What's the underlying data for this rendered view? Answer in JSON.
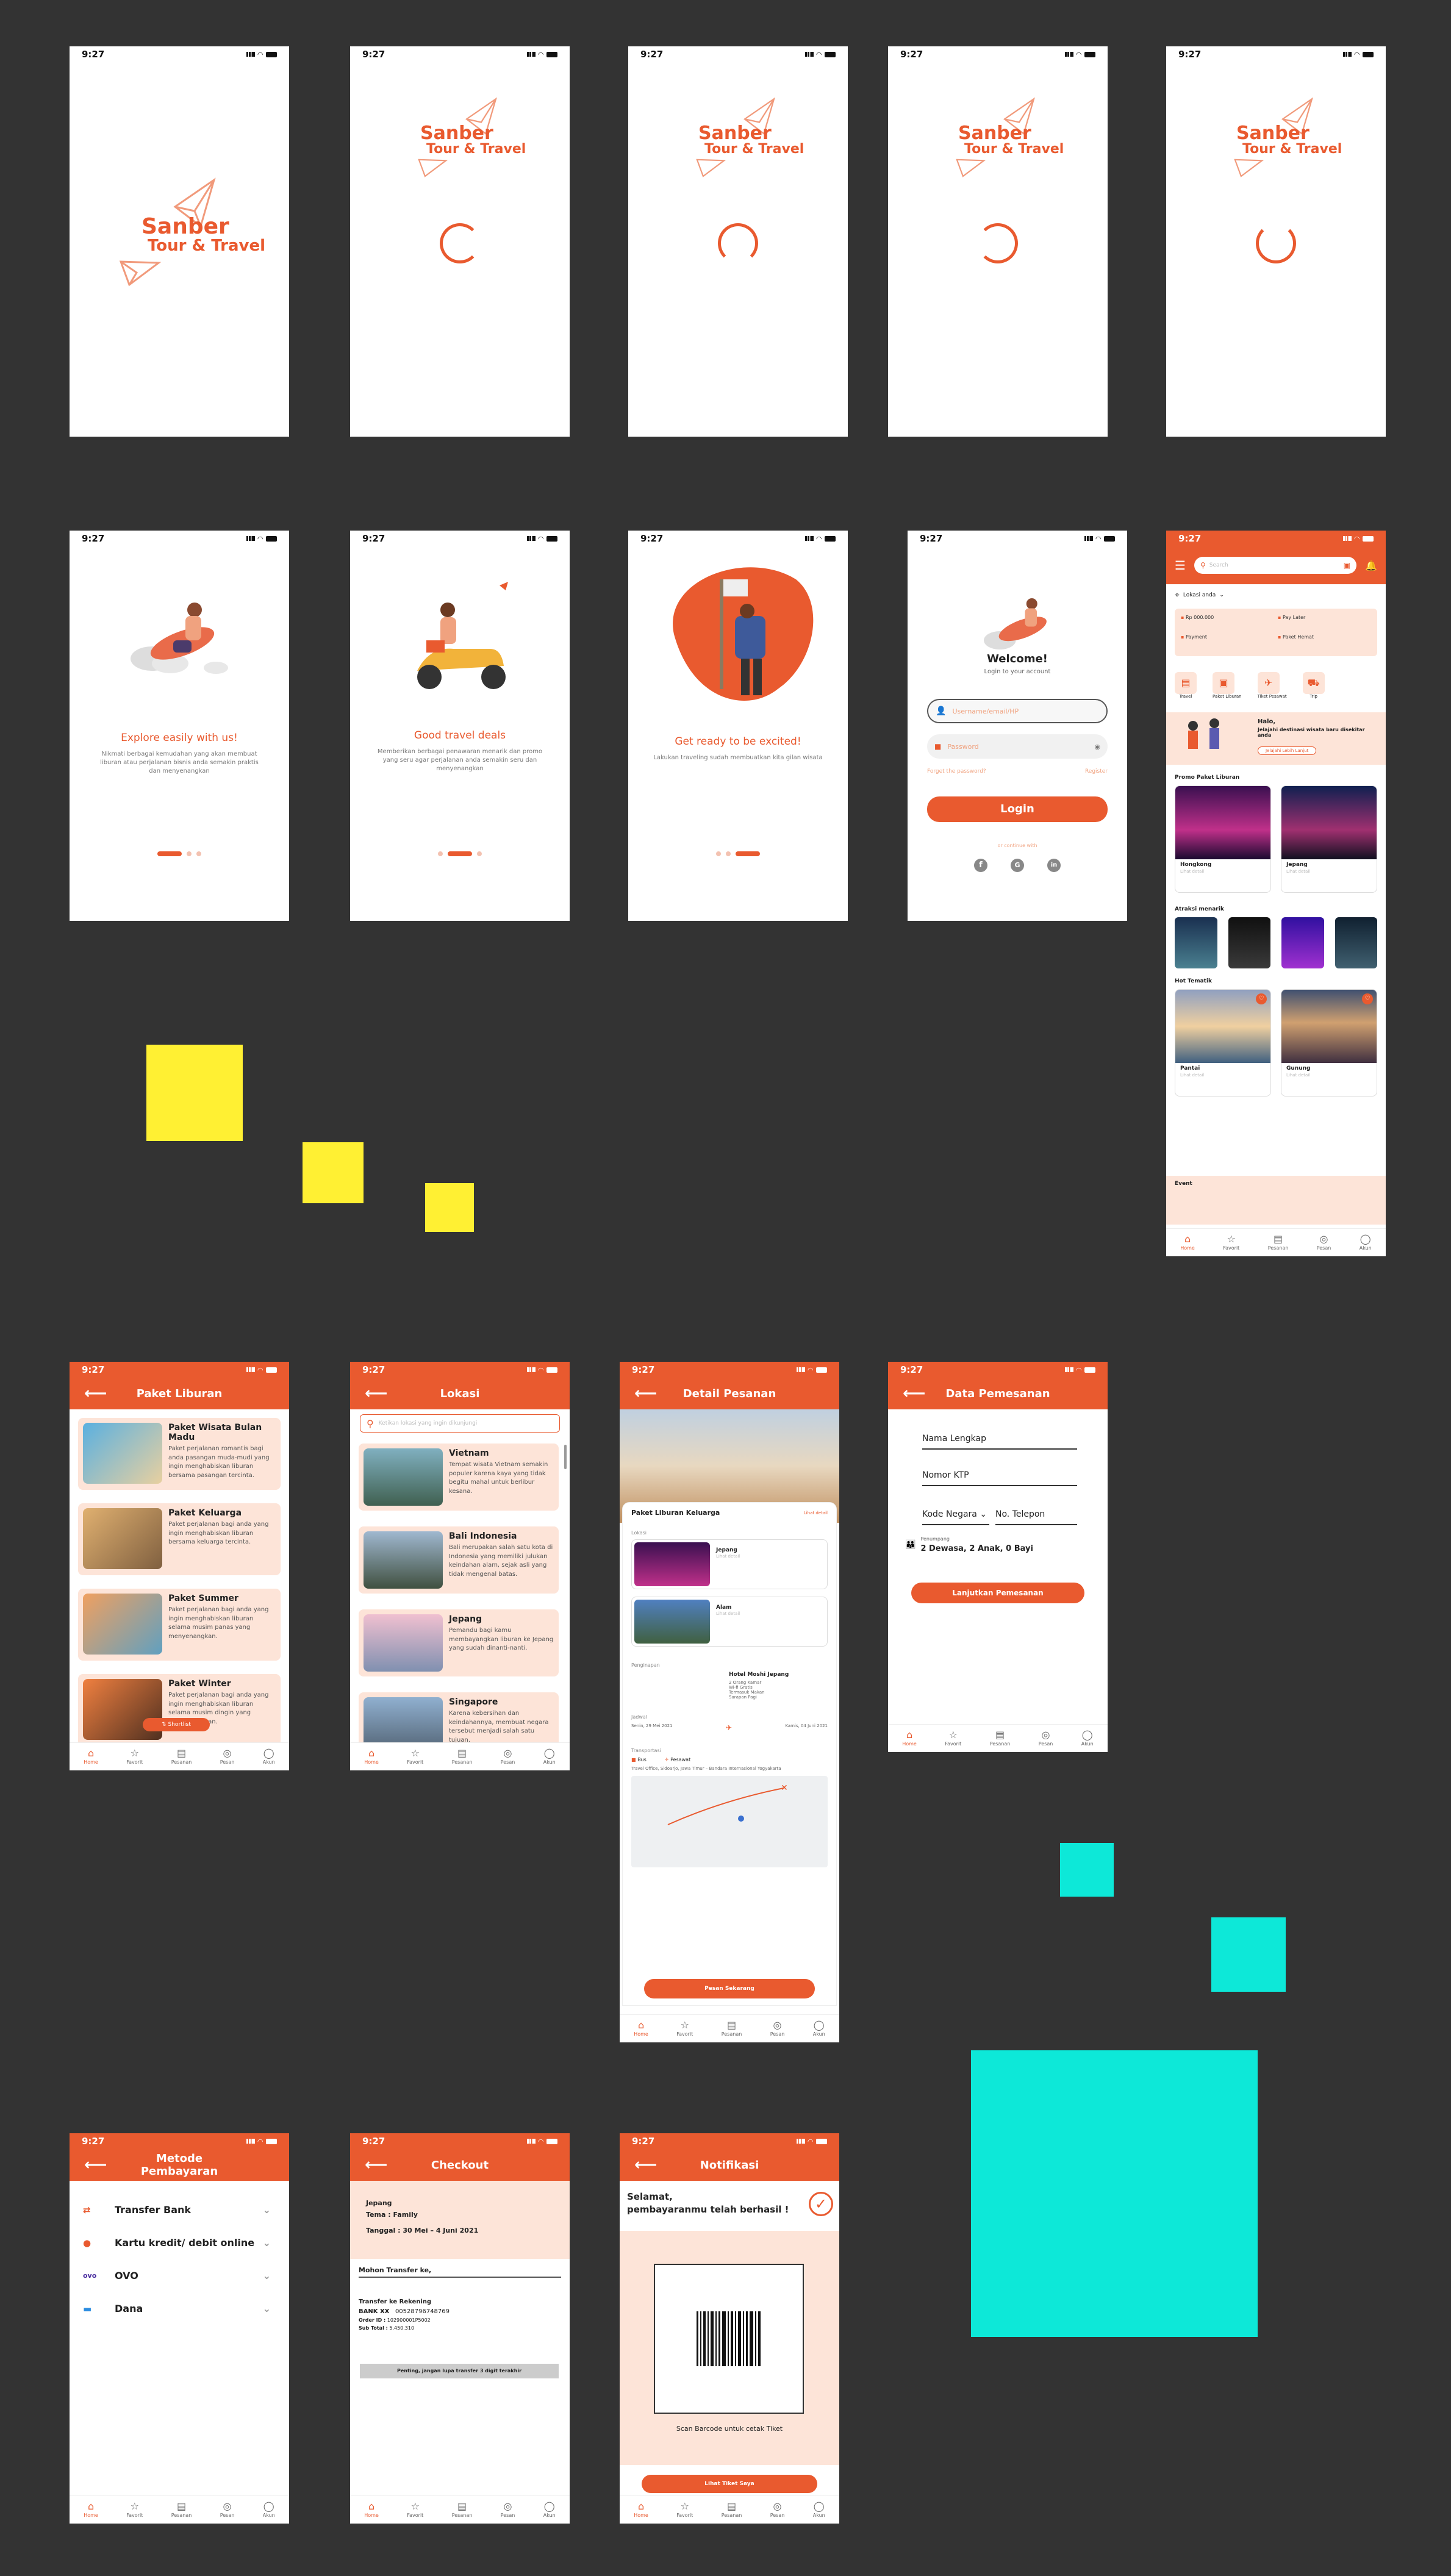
{
  "status_time": "9:27",
  "brand": {
    "line1": "Sanber",
    "line2": "Tour & Travel",
    "accent": "#e95a2f",
    "background": "#333333"
  },
  "onboarding": [
    {
      "title": "Explore easily with us!",
      "desc": "Nikmati berbagai kemudahan yang akan membuat liburan atau perjalanan bisnis anda semakin praktis dan menyenangkan"
    },
    {
      "title": "Good travel deals",
      "desc": "Memberikan berbagai penawaran menarik dan promo yang seru agar perjalanan anda semakin seru dan menyenangkan"
    },
    {
      "title": "Get ready to be excited!",
      "desc": "Lakukan traveling sudah membuatkan kita gilan wisata"
    }
  ],
  "login": {
    "title": "Welcome!",
    "subtitle": "Login to your account",
    "username_placeholder": "Username/email/HP",
    "password_placeholder": "Password",
    "forgot": "Forget the password?",
    "register": "Register",
    "button": "Login",
    "or": "or continue with"
  },
  "home": {
    "search_placeholder": "Search",
    "location": "Lokasi anda",
    "promo_items": [
      "Rp 000.000",
      "Pay Later",
      "Payment",
      "Paket Hemat"
    ],
    "categories": [
      "Travel",
      "Paket Liburan",
      "Tiket Pesawat",
      "Trip"
    ],
    "hello": "Halo,",
    "hello_sub": "Jelajahi destinasi wisata baru disekitar anda",
    "hello_btn": "Jelajahi Lebih Lanjut",
    "promo_title": "Promo Paket Liburan",
    "promo_cards": [
      {
        "name": "Hongkong",
        "price": "Lihat detail"
      },
      {
        "name": "Jepang",
        "price": "Lihat detail"
      }
    ],
    "attraction_title": "Atraksi menarik",
    "theme_title": "Hot Tematik",
    "theme_cards": [
      {
        "name": "Pantai",
        "price": "Lihat detail"
      },
      {
        "name": "Gunung",
        "price": "Lihat detail"
      }
    ],
    "event_title": "Event"
  },
  "nav": [
    "Home",
    "Favorit",
    "Pesanan",
    "Pesan",
    "Akun"
  ],
  "paket": {
    "title": "Paket Liburan",
    "items": [
      {
        "name": "Paket Wisata Bulan Madu",
        "desc": "Paket perjalanan romantis bagi anda pasangan muda-mudi yang ingin menghabiskan liburan bersama pasangan tercinta."
      },
      {
        "name": "Paket Keluarga",
        "desc": "Paket perjalanan bagi anda yang ingin menghabiskan liburan bersama keluarga tercinta."
      },
      {
        "name": "Paket Summer",
        "desc": "Paket perjalanan bagi anda yang ingin menghabiskan liburan selama musim panas yang menyenangkan."
      },
      {
        "name": "Paket Winter",
        "desc": "Paket perjalanan bagi anda yang ingin menghabiskan liburan selama musim dingin yang menyenangkan."
      }
    ],
    "filter": "Shortlist"
  },
  "lokasi": {
    "title": "Lokasi",
    "search": "Ketikan lokasi yang ingin dikunjungi",
    "items": [
      {
        "name": "Vietnam",
        "desc": "Tempat wisata Vietnam semakin populer karena kaya yang tidak begitu mahal untuk berlibur kesana."
      },
      {
        "name": "Bali Indonesia",
        "desc": "Bali merupakan salah satu kota di Indonesia yang memiliki julukan keindahan alam, sejak asli yang tidak mengenal batas."
      },
      {
        "name": "Jepang",
        "desc": "Pemandu bagi kamu membayangkan liburan ke Jepang yang sudah dinanti-nanti."
      },
      {
        "name": "Singapore",
        "desc": "Karena kebersihan dan keindahannya, membuat negara tersebut menjadi salah satu tujuan."
      }
    ]
  },
  "detail": {
    "title": "Detail Pesanan",
    "package": "Paket Liburan Keluarga",
    "link": "Lihat detail",
    "lokasi_label": "Lokasi",
    "places": [
      {
        "name": "Jepang",
        "sub": "Lihat detail"
      },
      {
        "name": "Alam",
        "sub": "Lihat detail"
      }
    ],
    "penginapan_label": "Penginapan",
    "hotel": "Hotel Moshi Jepang",
    "facilities": [
      "2 Orang Kamar",
      "Wi-fi Gratis",
      "Termasuk Makan",
      "Sarapan Pagi"
    ],
    "jadwal_label": "Jadwal",
    "depart": "Senin, 29 Mei 2021",
    "return": "Kamis, 04 Juni 2021",
    "transport_label": "Transportasi",
    "bus": "Bus",
    "plane": "Pesawat",
    "address": "Travel Office, Sidoarjo, Jawa Timur – Bandara Internasional Yogyakarta",
    "button": "Pesan Sekarang"
  },
  "data_pemesanan": {
    "title": "Data Pemesanan",
    "nama": "Nama Lengkap",
    "ktp": "Nomor KTP",
    "kode": "Kode Negara",
    "telepon": "No. Telepon",
    "penumpang_label": "Penumpang",
    "penumpang": "2 Dewasa, 2 Anak, 0 Bayi",
    "button": "Lanjutkan Pemesanan"
  },
  "metode": {
    "title": "Metode Pembayaran",
    "items": [
      "Transfer Bank",
      "Kartu kredit/ debit online",
      "OVO",
      "Dana"
    ]
  },
  "checkout": {
    "title": "Checkout",
    "dest": "Jepang",
    "tema": "Tema : Family",
    "tanggal": "Tanggal : 30 Mei – 4 Juni 2021",
    "mohon": "Mohon Transfer ke,",
    "transfer": "Transfer ke Rekening",
    "bank_label": "BANK XX",
    "bank_no": "00528796748769",
    "order_label": "Order ID :",
    "order": "102900001P5002",
    "subtotal_label": "Sub Total :",
    "subtotal": "5.450.310",
    "note": "Penting, jangan lupa transfer 3 digit terakhir"
  },
  "notif": {
    "title": "Notifikasi",
    "msg1": "Selamat,",
    "msg2": "pembayaranmu telah berhasil !",
    "scan": "Scan Barcode untuk cetak Tiket",
    "button": "Lihat Tiket Saya"
  }
}
